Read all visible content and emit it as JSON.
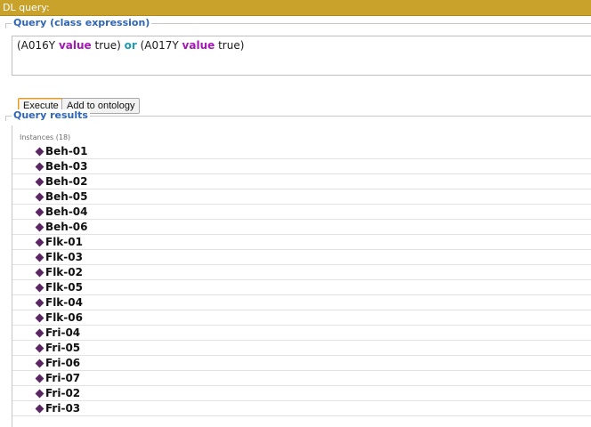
{
  "window": {
    "title": "DL query:"
  },
  "query": {
    "section_title": "Query (class expression)",
    "expression_tokens": [
      {
        "text": "(A016Y ",
        "kind": "plain"
      },
      {
        "text": "value",
        "kind": "keyword-value"
      },
      {
        "text": " true) ",
        "kind": "plain"
      },
      {
        "text": "or",
        "kind": "keyword-or"
      },
      {
        "text": " (A017Y ",
        "kind": "plain"
      },
      {
        "text": "value",
        "kind": "keyword-value"
      },
      {
        "text": " true)",
        "kind": "plain"
      }
    ],
    "execute_label": "Execute",
    "add_label": "Add to ontology"
  },
  "results": {
    "section_title": "Query results",
    "instances_header": "Instances (18)",
    "items": [
      "Beh-01",
      "Beh-03",
      "Beh-02",
      "Beh-05",
      "Beh-04",
      "Beh-06",
      "Flk-01",
      "Flk-03",
      "Flk-02",
      "Flk-05",
      "Flk-04",
      "Flk-06",
      "Fri-04",
      "Fri-05",
      "Fri-06",
      "Fri-07",
      "Fri-02",
      "Fri-03"
    ]
  },
  "colors": {
    "title_bar": "#c9a22b",
    "section_title": "#2d65b8",
    "keyword_value": "#a319b5",
    "keyword_or": "#1f9bb3",
    "individual_icon": "#5b2463"
  },
  "icons": {
    "individual": "diamond-icon"
  }
}
